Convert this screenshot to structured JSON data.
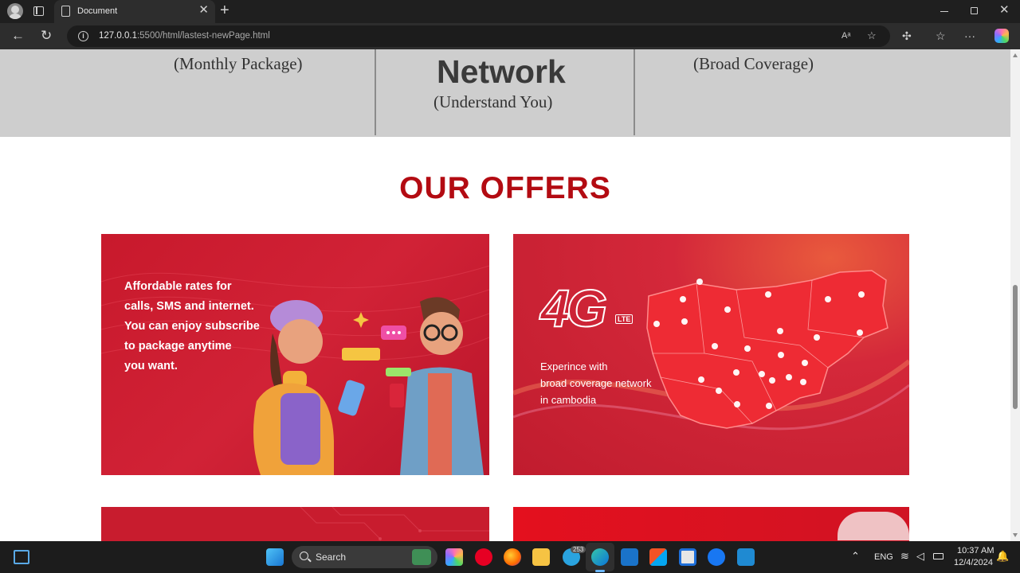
{
  "browser": {
    "tab_title": "Document",
    "url_host": "127.0.0.1",
    "url_rest": ":5500/html/lastest-newPage.html"
  },
  "features": {
    "left_subtitle": "(Monthly Package)",
    "center_title": "Network",
    "center_subtitle": "(Understand You)",
    "right_subtitle": "(Broad Coverage)"
  },
  "offers": {
    "heading": "OUR OFFERS",
    "cards": [
      {
        "lines": [
          "Affordable rates for",
          "calls, SMS and internet.",
          "You can enjoy subscribe",
          "to package anytime",
          "you want."
        ]
      },
      {
        "logo": "4G",
        "logo_badge": "LTE",
        "lines": [
          "Experince with",
          "broad coverage network",
          "in cambodia"
        ]
      }
    ]
  },
  "taskbar": {
    "search_label": "Search",
    "language": "ENG",
    "time": "10:37 AM",
    "date": "12/4/2024",
    "telegram_badge": "253"
  },
  "colors": {
    "brand_red": "#b30b12",
    "card_red": "#c61f2e"
  }
}
